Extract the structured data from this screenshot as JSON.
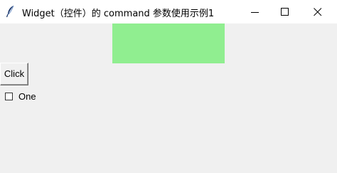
{
  "window": {
    "title": "Widget（控件）的 command 参数使用示例1",
    "controls": {
      "minimize": "minimize-icon",
      "maximize": "maximize-icon",
      "close": "close-icon"
    }
  },
  "main": {
    "frame_color": "#90ee90",
    "button_label": "Click",
    "checkbox": {
      "label": "One",
      "checked": false
    }
  }
}
